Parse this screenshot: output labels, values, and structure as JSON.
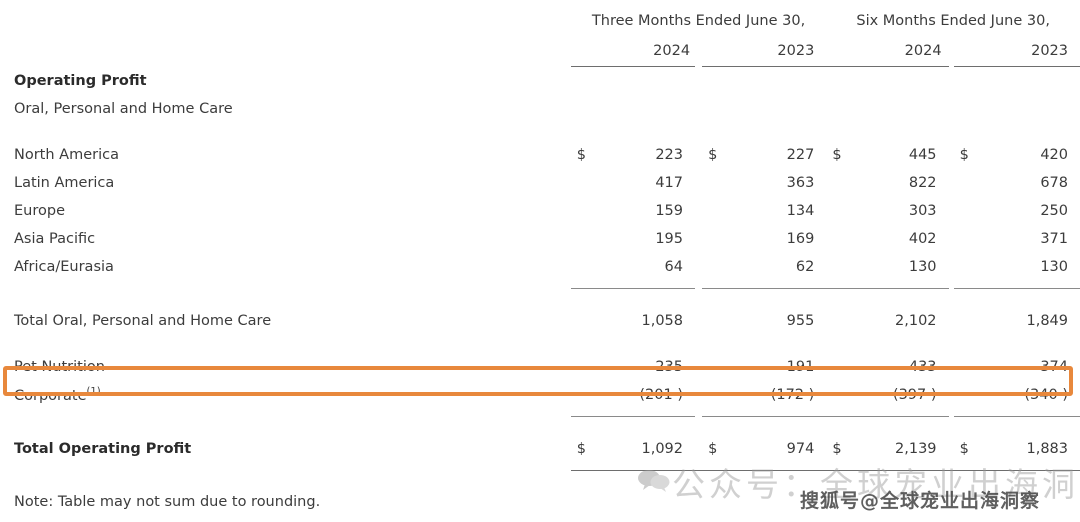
{
  "table": {
    "header": {
      "spans": [
        {
          "label": "Three Months Ended June 30,"
        },
        {
          "label": "Six Months Ended June 30,"
        }
      ],
      "years": [
        "2024",
        "2023",
        "2024",
        "2023"
      ]
    },
    "sections": [
      {
        "label": "Operating Profit",
        "bold": true
      },
      {
        "label": "Oral, Personal and Home Care",
        "bold": false
      }
    ],
    "rows": [
      {
        "label": "North America",
        "symbols": [
          "$",
          "$",
          "$",
          "$"
        ],
        "values": [
          "223",
          "227",
          "445",
          "420"
        ]
      },
      {
        "label": "Latin America",
        "symbols": [
          "",
          "",
          "",
          ""
        ],
        "values": [
          "417",
          "363",
          "822",
          "678"
        ]
      },
      {
        "label": "Europe",
        "symbols": [
          "",
          "",
          "",
          ""
        ],
        "values": [
          "159",
          "134",
          "303",
          "250"
        ]
      },
      {
        "label": "Asia Pacific",
        "symbols": [
          "",
          "",
          "",
          ""
        ],
        "values": [
          "195",
          "169",
          "402",
          "371"
        ]
      },
      {
        "label": "Africa/Eurasia",
        "symbols": [
          "",
          "",
          "",
          ""
        ],
        "values": [
          "64",
          "62",
          "130",
          "130"
        ]
      }
    ],
    "subtotal": {
      "label": "Total Oral, Personal and Home Care",
      "symbols": [
        "",
        "",
        "",
        ""
      ],
      "values": [
        "1,058",
        "955",
        "2,102",
        "1,849"
      ]
    },
    "pet_nutrition": {
      "label": "Pet Nutrition",
      "symbols": [
        "",
        "",
        "",
        ""
      ],
      "values": [
        "235",
        "191",
        "433",
        "374"
      ],
      "highlighted": true,
      "highlight_color": "#E8883C"
    },
    "corporate": {
      "label": "Corporate",
      "footnote": "(1)",
      "symbols": [
        "",
        "",
        "",
        ""
      ],
      "values": [
        "(201 )",
        "(172 )",
        "(397 )",
        "(340 )"
      ]
    },
    "total": {
      "label": "Total Operating Profit",
      "symbols": [
        "$",
        "$",
        "$",
        "$"
      ],
      "values": [
        "1,092",
        "974",
        "2,139",
        "1,883"
      ]
    }
  },
  "note": "Note: Table may not sum due to rounding.",
  "watermarks": {
    "wechat": "公众号：全球宠业出海洞察",
    "sohu": "搜狐号@全球宠业出海洞察",
    "logo_icon": "speech-bubble-icon"
  }
}
